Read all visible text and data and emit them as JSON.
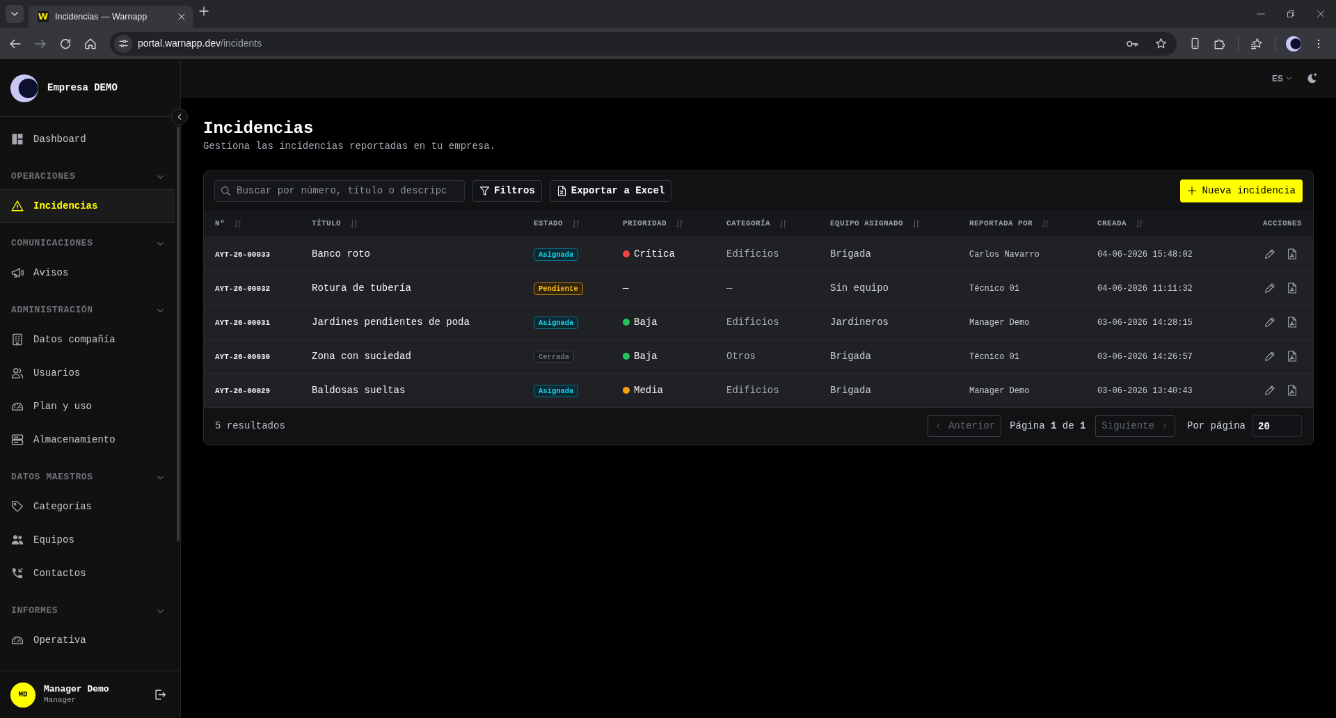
{
  "browser": {
    "tab": {
      "favicon_text": "W",
      "title": "Incidencias — Warnapp"
    },
    "url": {
      "host": "portal.warnapp.dev",
      "path": "/incidents"
    }
  },
  "sidebar": {
    "company": "Empresa DEMO",
    "nav": [
      {
        "kind": "link",
        "label": "Dashboard",
        "selected": false
      },
      {
        "kind": "section",
        "label": "OPERACIONES",
        "expanded": true,
        "children": [
          {
            "kind": "link",
            "label": "Incidencias",
            "selected": true
          }
        ]
      },
      {
        "kind": "section",
        "label": "COMUNICACIONES",
        "expanded": true,
        "children": [
          {
            "kind": "link",
            "label": "Avisos",
            "selected": false
          }
        ]
      },
      {
        "kind": "section",
        "label": "ADMINISTRACIÓN",
        "expanded": true,
        "children": [
          {
            "kind": "link",
            "label": "Datos compañía",
            "selected": false
          },
          {
            "kind": "link",
            "label": "Usuarios",
            "selected": false
          },
          {
            "kind": "link",
            "label": "Plan y uso",
            "selected": false
          },
          {
            "kind": "link",
            "label": "Almacenamiento",
            "selected": false
          }
        ]
      },
      {
        "kind": "section",
        "label": "DATOS MAESTROS",
        "expanded": true,
        "children": [
          {
            "kind": "link",
            "label": "Categorías",
            "selected": false
          },
          {
            "kind": "link",
            "label": "Equipos",
            "selected": false
          },
          {
            "kind": "link",
            "label": "Contactos",
            "selected": false
          }
        ]
      },
      {
        "kind": "section",
        "label": "INFORMES",
        "expanded": true,
        "children": [
          {
            "kind": "link",
            "label": "Operativa",
            "selected": false
          }
        ]
      }
    ],
    "user": {
      "initials": "MD",
      "name": "Manager Demo",
      "role": "Manager"
    }
  },
  "header": {
    "language": "ES"
  },
  "page": {
    "title": "Incidencias",
    "subtitle": "Gestiona las incidencias reportadas en tu empresa."
  },
  "toolbar": {
    "search": {
      "placeholder": "Buscar por número, título o descripc"
    },
    "buttons": [
      {
        "label": "Filtros"
      },
      {
        "label": "Exportar a Excel"
      }
    ],
    "primary_button": {
      "label": "Nueva incidencia"
    }
  },
  "table": {
    "columns": [
      {
        "label": "Nº",
        "sortable": true
      },
      {
        "label": "TÍTULO",
        "sortable": true
      },
      {
        "label": "ESTADO",
        "sortable": true
      },
      {
        "label": "PRIORIDAD",
        "sortable": true
      },
      {
        "label": "CATEGORÍA",
        "sortable": true
      },
      {
        "label": "EQUIPO ASIGNADO",
        "sortable": true
      },
      {
        "label": "REPORTADA POR",
        "sortable": true
      },
      {
        "label": "CREADA",
        "sortable": true
      },
      {
        "label": "ACCIONES",
        "sortable": false
      }
    ],
    "rows": [
      {
        "number": "AYT-26-00033",
        "title": "Banco roto",
        "status": {
          "label": "Asignada",
          "kind": "assigned"
        },
        "priority": {
          "label": "Crítica",
          "color": "#ef4444"
        },
        "category": "Edificios",
        "team": "Brigada",
        "reported_by": "Carlos Navarro",
        "created": "04-06-2026 15:48:02"
      },
      {
        "number": "AYT-26-00032",
        "title": "Rotura de tubería",
        "status": {
          "label": "Pendiente",
          "kind": "pending"
        },
        "priority": {
          "label": "—"
        },
        "category": "—",
        "team": "Sin equipo",
        "reported_by": "Técnico 01",
        "created": "04-06-2026 11:11:32"
      },
      {
        "number": "AYT-26-00031",
        "title": "Jardines pendientes de poda",
        "status": {
          "label": "Asignada",
          "kind": "assigned"
        },
        "priority": {
          "label": "Baja",
          "color": "#22c55e"
        },
        "category": "Edificios",
        "team": "Jardineros",
        "reported_by": "Manager Demo",
        "created": "03-06-2026 14:28:15"
      },
      {
        "number": "AYT-26-00030",
        "title": "Zona con suciedad",
        "status": {
          "label": "Cerrada",
          "kind": "closed"
        },
        "priority": {
          "label": "Baja",
          "color": "#22c55e"
        },
        "category": "Otros",
        "team": "Brigada",
        "reported_by": "Técnico 01",
        "created": "03-06-2026 14:26:57"
      },
      {
        "number": "AYT-26-00029",
        "title": "Baldosas sueltas",
        "status": {
          "label": "Asignada",
          "kind": "assigned"
        },
        "priority": {
          "label": "Media",
          "color": "#f59e0b"
        },
        "category": "Edificios",
        "team": "Brigada",
        "reported_by": "Manager Demo",
        "created": "03-06-2026 13:40:43"
      }
    ]
  },
  "footer": {
    "results": "5 resultados",
    "previous": {
      "label": "Anterior",
      "disabled": true
    },
    "page_info": "Página **1** de **1**",
    "next": {
      "label": "Siguiente",
      "disabled": true
    },
    "page_size_label": "Por página",
    "page_size": "20"
  }
}
